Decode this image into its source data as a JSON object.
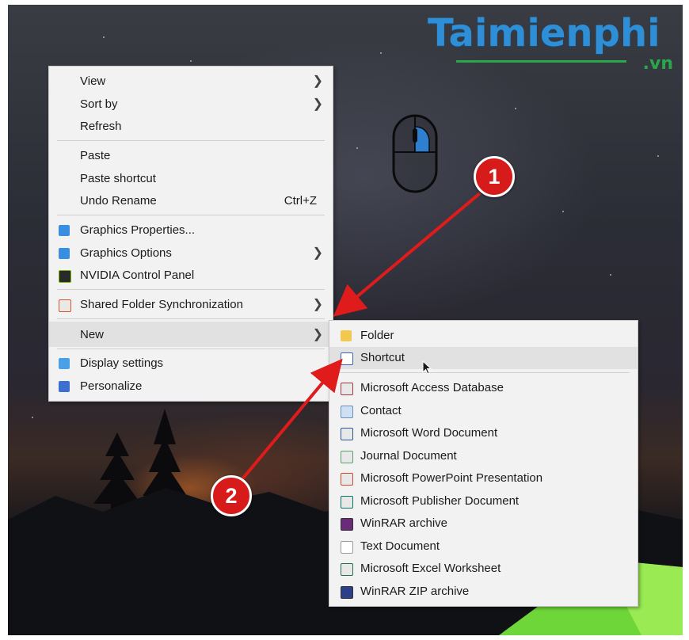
{
  "watermark": {
    "brand": "Taimienphi",
    "tld": ".vn"
  },
  "context_menu": {
    "items": [
      {
        "label": "View",
        "submenu": true
      },
      {
        "label": "Sort by",
        "submenu": true
      },
      {
        "label": "Refresh"
      },
      {
        "label": "Paste"
      },
      {
        "label": "Paste shortcut"
      },
      {
        "label": "Undo Rename",
        "shortcut": "Ctrl+Z"
      },
      {
        "label": "Graphics Properties...",
        "icon": "intel-graphics-icon"
      },
      {
        "label": "Graphics Options",
        "icon": "intel-graphics-icon",
        "submenu": true
      },
      {
        "label": "NVIDIA Control Panel",
        "icon": "nvidia-icon"
      },
      {
        "label": "Shared Folder Synchronization",
        "icon": "sync-icon",
        "submenu": true
      },
      {
        "label": "New",
        "submenu": true,
        "highlighted": true
      },
      {
        "label": "Display settings",
        "icon": "display-icon"
      },
      {
        "label": "Personalize",
        "icon": "personalize-icon"
      }
    ]
  },
  "new_submenu": {
    "items": [
      {
        "label": "Folder",
        "icon": "folder-icon"
      },
      {
        "label": "Shortcut",
        "icon": "shortcut-icon",
        "highlighted": true
      },
      {
        "label": "Microsoft Access Database",
        "icon": "access-icon"
      },
      {
        "label": "Contact",
        "icon": "contact-icon"
      },
      {
        "label": "Microsoft Word Document",
        "icon": "word-icon"
      },
      {
        "label": "Journal Document",
        "icon": "journal-icon"
      },
      {
        "label": "Microsoft PowerPoint Presentation",
        "icon": "powerpoint-icon"
      },
      {
        "label": "Microsoft Publisher Document",
        "icon": "publisher-icon"
      },
      {
        "label": "WinRAR archive",
        "icon": "winrar-icon"
      },
      {
        "label": "Text Document",
        "icon": "text-icon"
      },
      {
        "label": "Microsoft Excel Worksheet",
        "icon": "excel-icon"
      },
      {
        "label": "WinRAR ZIP archive",
        "icon": "winrar-zip-icon"
      }
    ]
  },
  "callouts": [
    {
      "number": "1"
    },
    {
      "number": "2"
    }
  ],
  "colors": {
    "menu_bg": "#f2f2f2",
    "highlight": "#e1e1e1",
    "callout_red": "#d71a1a",
    "brand_blue": "#2f8fd6",
    "brand_green": "#2aa74a"
  }
}
